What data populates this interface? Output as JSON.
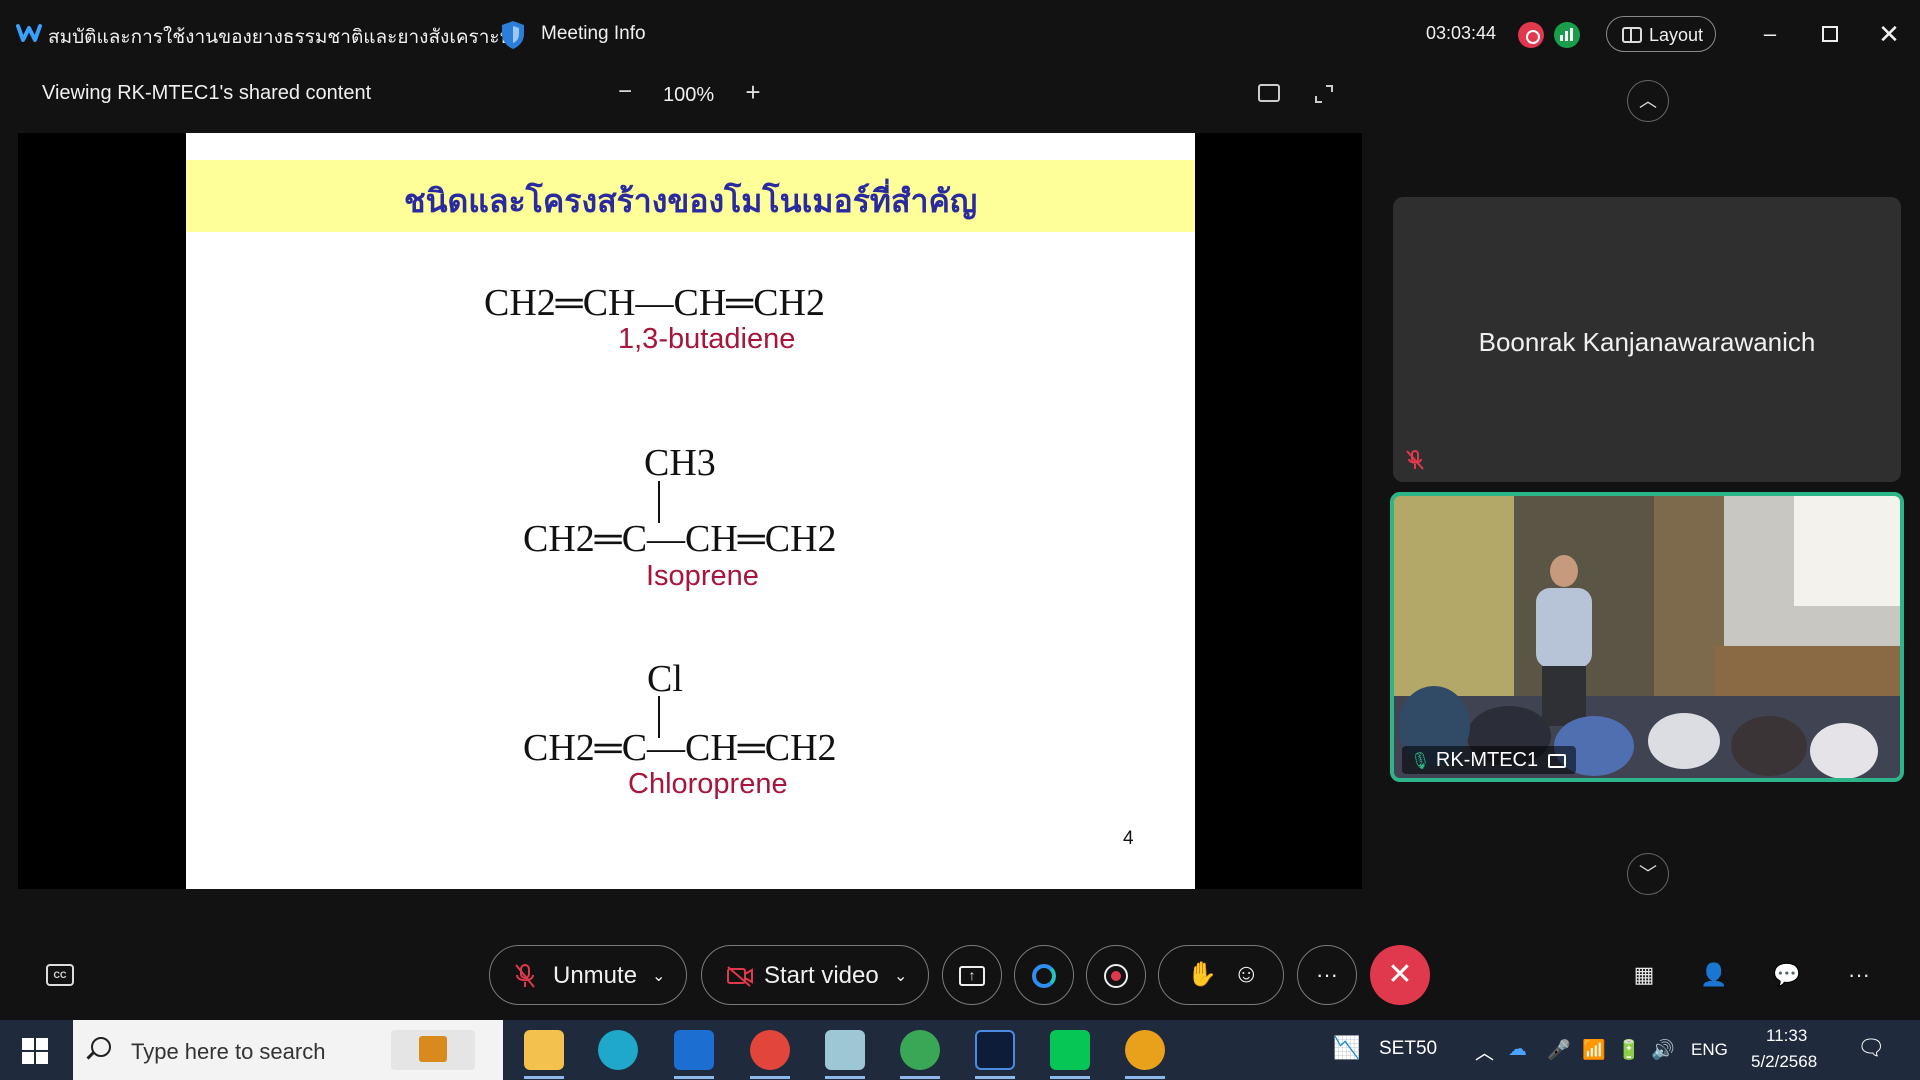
{
  "title_bar": {
    "meeting_title": "สมบัติและการใช้งานของยางธรรมชาติและยางสังเคราะห์",
    "meeting_info": "Meeting Info",
    "timer": "03:03:44",
    "layout_label": "Layout"
  },
  "share_header": {
    "viewing_label": "Viewing RK-MTEC1's shared content",
    "zoom_minus": "−",
    "zoom_value": "100%",
    "zoom_plus": "+"
  },
  "slide": {
    "title": "ชนิดและโครงสร้างของโมโนเมอร์ที่สำคัญ",
    "monomers": [
      {
        "formula": "CH2═CH—CH═CH2",
        "name": "1,3-butadiene",
        "substituent": ""
      },
      {
        "formula": "CH2═C—CH═CH2",
        "name": "Isoprene",
        "substituent": "CH3"
      },
      {
        "formula": "CH2═C—CH═CH2",
        "name": "Chloroprene",
        "substituent": "Cl"
      }
    ],
    "page_number": "4"
  },
  "participants": {
    "name_tile": "Boonrak Kanjanawarawanich",
    "video_tile_label": "RK-MTEC1"
  },
  "controls": {
    "unmute_label": "Unmute",
    "start_video_label": "Start video",
    "more_label": "···"
  },
  "taskbar": {
    "search_placeholder": "Type here to search",
    "set50_label": "SET50",
    "language": "ENG",
    "time": "11:33",
    "date": "5/2/2568"
  },
  "colors": {
    "end_call": "#e0384d",
    "active_speaker_border": "#2db58a",
    "slide_banner": "#ffff99",
    "slide_title": "#2a2aa0",
    "monomer_name": "#a8153c"
  }
}
